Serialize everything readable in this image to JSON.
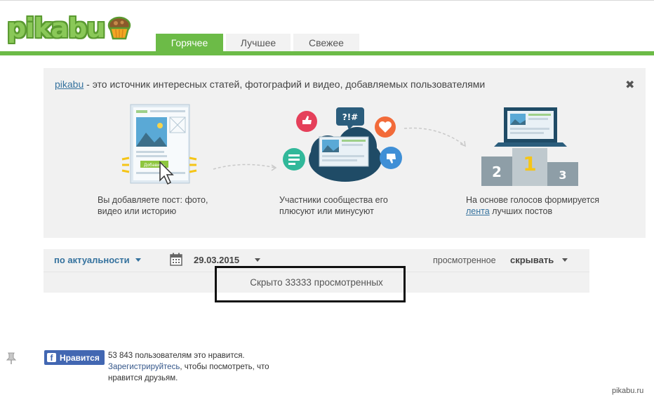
{
  "header": {
    "logo_text": "pikabu",
    "tabs": [
      {
        "label": "Горячее",
        "active": true
      },
      {
        "label": "Лучшее",
        "active": false
      },
      {
        "label": "Свежее",
        "active": false
      }
    ],
    "accent_color": "#6cbb47"
  },
  "intro": {
    "site_link": "pikabu",
    "headline_rest": " - это источник интересных статей, фотографий и видео, добавляемых пользователями",
    "close_icon": "✖",
    "step1": {
      "text": "Вы добавляете пост: фото, видео или историю",
      "button_text": "Добавить"
    },
    "step2": {
      "text": "Участники сообщества его плюсуют или минусуют",
      "bubble_text": "?!#"
    },
    "step3": {
      "text_before": "На основе голосов формируется ",
      "link": "лента",
      "text_after": " лучших постов",
      "places": [
        "2",
        "1",
        "3"
      ]
    }
  },
  "sortbar": {
    "sort_label": "по актуальности",
    "date": "29.03.2015",
    "viewed_label": "просмотренное",
    "viewed_action": "скрывать"
  },
  "hidden_notice": "Скрыто 33333 просмотренных",
  "facebook": {
    "button_label": "Нравится",
    "icon_letter": "f",
    "count_text": "53 843 пользователям это нравится.",
    "register_link": "Зарегистрируйтесь",
    "register_rest": ", чтобы посмотреть, что нравится друзьям."
  },
  "watermark": "pikabu.ru"
}
